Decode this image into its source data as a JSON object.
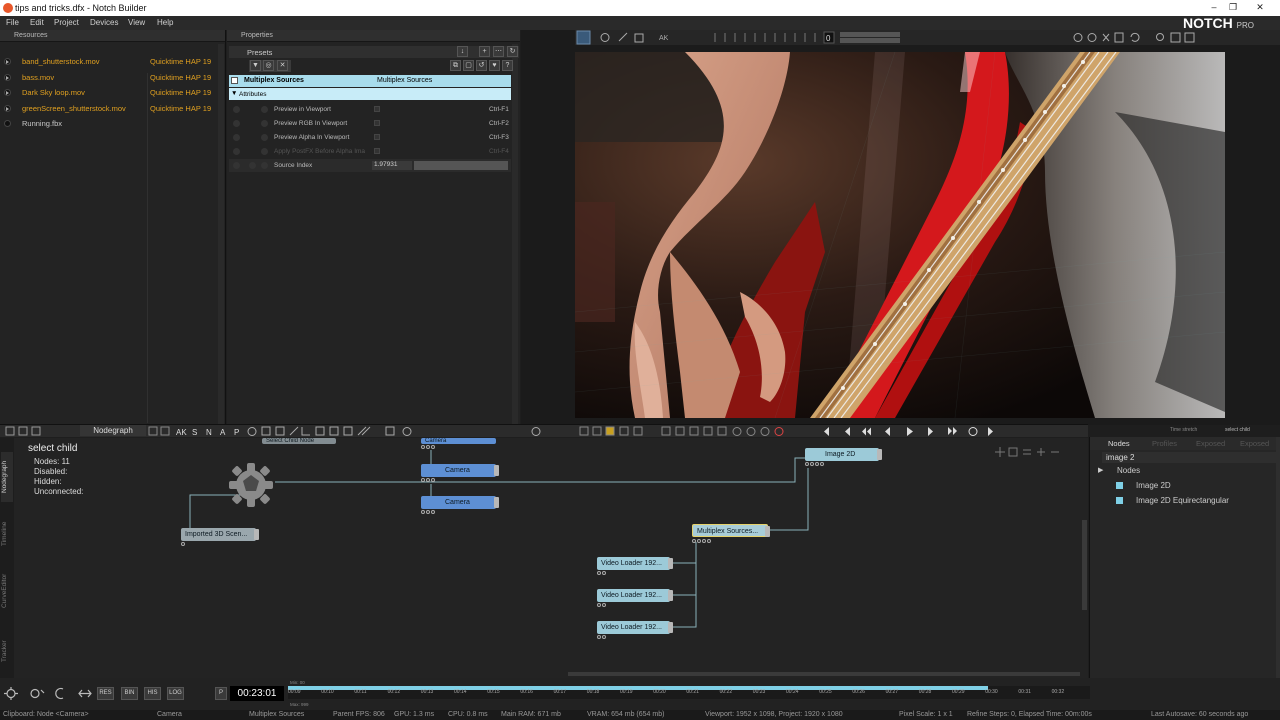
{
  "window": {
    "title": "tips and tricks.dfx - Notch Builder",
    "logo": "NOTCH",
    "logo_suffix": "PRO",
    "controls": [
      "–",
      "❐",
      "✕"
    ]
  },
  "menu": [
    "File",
    "Edit",
    "Project",
    "Devices",
    "View",
    "Help"
  ],
  "resources": {
    "header": "Resources",
    "items": [
      {
        "name": "band_shutterstock.mov",
        "type": "Quicktime HAP 19"
      },
      {
        "name": "bass.mov",
        "type": "Quicktime HAP 19"
      },
      {
        "name": "Dark Sky loop.mov",
        "type": "Quicktime HAP 19"
      },
      {
        "name": "greenScreen_shutterstock.mov",
        "type": "Quicktime HAP 19"
      },
      {
        "name": "Running.fbx",
        "type": ""
      }
    ]
  },
  "properties": {
    "header": "Properties",
    "presets_label": "Presets",
    "node_title": "Multiplex Sources",
    "node_type": "Multiplex Sources",
    "attributes_label": "Attributes",
    "rows": [
      {
        "name": "Preview in Viewport",
        "shortcut": "Ctrl-F1"
      },
      {
        "name": "Preview RGB In Viewport",
        "shortcut": "Ctrl-F2"
      },
      {
        "name": "Preview Alpha In Viewport",
        "shortcut": "Ctrl-F3"
      },
      {
        "name": "Apply PostFX Before Alpha Ima",
        "shortcut": "Ctrl-F4"
      }
    ],
    "source_index": {
      "label": "Source Index",
      "value": "1.97931"
    }
  },
  "viewport": {
    "toolbar_value": "0"
  },
  "nodegraph": {
    "title": "Nodegraph",
    "toolbar_letters": [
      "AK",
      "S",
      "N",
      "A",
      "P"
    ],
    "side_tabs": [
      "Nodegraph",
      "Timeline",
      "CurveEditor",
      "Tracker"
    ],
    "info": {
      "title": "select  child",
      "lines": [
        "Nodes:   11",
        "Disabled:",
        "Hidden:",
        "Unconnected:"
      ]
    },
    "nodes": {
      "select_child": "Select  Child  Node",
      "camera_top": "Camera",
      "camera_1": "Camera",
      "camera_2": "Camera",
      "imported": "Imported  3D  Scen...",
      "image2d": "Image  2D",
      "multiplex": "Multiplex  Sources...",
      "video1": "Video  Loader  192...",
      "video2": "Video  Loader  192...",
      "video3": "Video  Loader  192..."
    }
  },
  "playback": {
    "top_right_labels": [
      "Time stretch",
      "select child"
    ]
  },
  "nodes_panel": {
    "tabs": [
      "Nodes",
      "Profiles",
      "Exposed",
      "Exposed"
    ],
    "search": "image 2",
    "tree_root": "Nodes",
    "items": [
      "Image 2D",
      "Image 2D Equirectangular"
    ]
  },
  "timeline": {
    "buttons": [
      "RES",
      "BIN",
      "HIS",
      "LOG"
    ],
    "p_label": "P",
    "current_time": "00:23:01",
    "min_label": "Min: 00",
    "max_label": "Max: 999",
    "ticks": [
      "00:09",
      "00:10",
      "00:11",
      "00:12",
      "00:13",
      "00:14",
      "00:15",
      "00:16",
      "00:17",
      "00:18",
      "00:19",
      "00:20",
      "00:21",
      "00:22",
      "00:23",
      "00:24",
      "00:25",
      "00:26",
      "00:27",
      "00:28",
      "00:29",
      "00:30",
      "00:31",
      "00:32"
    ],
    "progress": 0.873
  },
  "status": {
    "clipboard": "Clipboard: Node <Camera>",
    "camera": "Camera",
    "node": "Multiplex Sources",
    "parent_fps": "Parent FPS: 806",
    "gpu": "GPU: 1.3 ms",
    "cpu": "CPU: 0.8 ms",
    "ram": "Main RAM: 671 mb",
    "vram": "VRAM: 654 mb (654 mb)",
    "viewport": "Viewport: 1952 x 1098, Project: 1920 x 1080",
    "pixel_scale": "Pixel Scale: 1 x 1",
    "refine": "Refine Steps: 0, Elapsed Time: 00m:00s",
    "autosave": "Last Autosave: 60 seconds ago"
  },
  "colors": {
    "accent_cyan": "#7fd0e6",
    "resource_orange": "#e0a020",
    "node_blue": "#5d8fd4",
    "node_cyan": "#9ccad8"
  }
}
